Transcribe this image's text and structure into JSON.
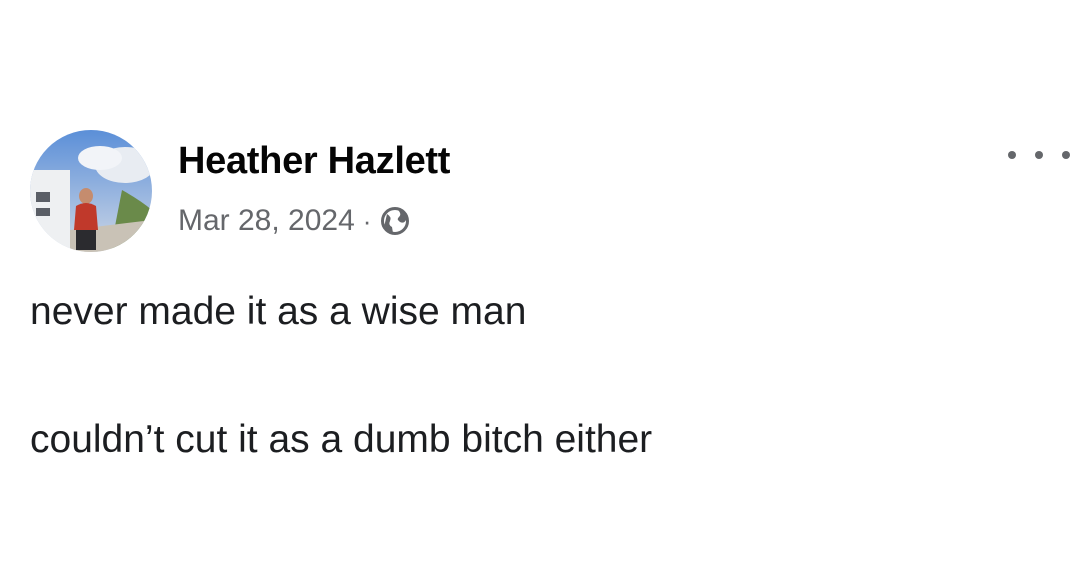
{
  "post": {
    "author": {
      "name": "Heather Hazlett",
      "avatar_icon": "profile-photo"
    },
    "meta": {
      "date": "Mar 28, 2024",
      "separator": "·",
      "audience_icon": "globe-icon"
    },
    "menu_icon": "more-options-icon",
    "body": {
      "lines": [
        "never made it as a wise man",
        "couldn’t cut it as a dumb bitch either"
      ]
    }
  },
  "colors": {
    "text_primary": "#050505",
    "text_secondary": "#65676b",
    "background": "#ffffff"
  }
}
